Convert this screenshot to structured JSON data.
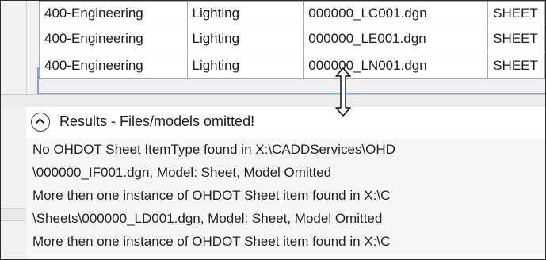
{
  "files_table": {
    "rows": [
      [
        "400-Engineering",
        "Lighting",
        "000000_LC001.dgn",
        "SHEET"
      ],
      [
        "400-Engineering",
        "Lighting",
        "000000_LE001.dgn",
        "SHEET"
      ],
      [
        "400-Engineering",
        "Lighting",
        "000000_LN001.dgn",
        "SHEET"
      ]
    ]
  },
  "results": {
    "title": "Results - Files/models omitted!",
    "messages": [
      "No OHDOT Sheet ItemType found in X:\\CADDServices\\OHD",
      "\\000000_IF001.dgn, Model: Sheet, Model Omitted",
      "More then one instance of OHDOT Sheet item found in X:\\C",
      "\\Sheets\\000000_LD001.dgn, Model: Sheet, Model Omitted",
      "More then one instance of OHDOT Sheet item found in X:\\C"
    ]
  },
  "icons": {
    "collapse": "chevron-up-circle-icon",
    "cursor": "vertical-resize-cursor-icon"
  },
  "colors": {
    "selection_edge": "#7aa7d8",
    "grid_line": "#a9a9a9"
  }
}
